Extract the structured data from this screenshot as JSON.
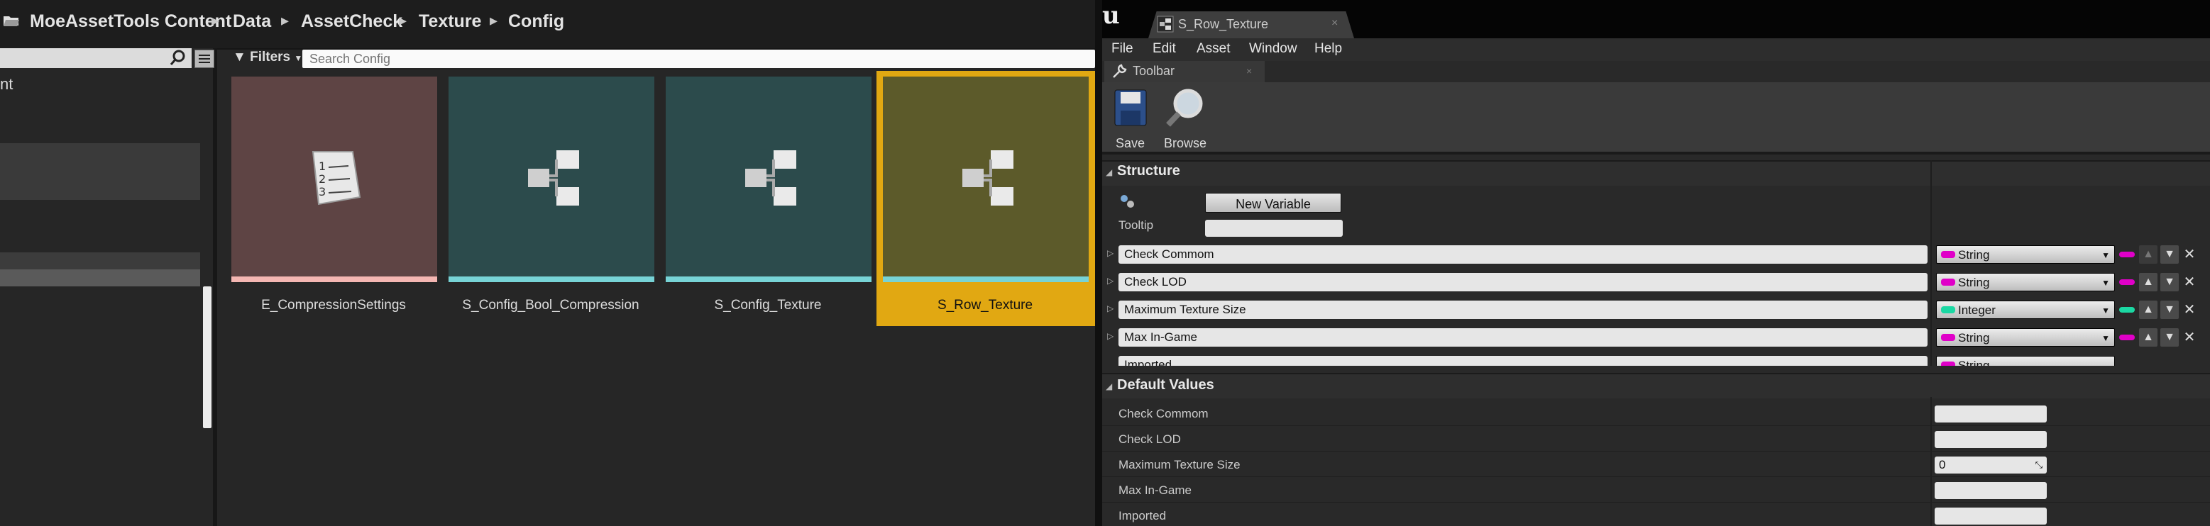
{
  "content_browser": {
    "breadcrumb": [
      "MoeAssetTools Content",
      "Data",
      "AssetCheck",
      "Texture",
      "Config"
    ],
    "tree_partial_label": "nt",
    "filters_label": "Filters",
    "search_placeholder": "Search Config",
    "assets": [
      {
        "name": "E_CompressionSettings",
        "color": "#5e4444",
        "bar": "#f4b6b2",
        "icon": "enum-list-icon"
      },
      {
        "name": "S_Config_Bool_Compression",
        "color": "#2c4b4c",
        "bar": "#77d3d6",
        "icon": "struct-icon"
      },
      {
        "name": "S_Config_Texture",
        "color": "#2c4b4c",
        "bar": "#77d3d6",
        "icon": "struct-icon"
      },
      {
        "name": "S_Row_Texture",
        "color": "#5c5a2a",
        "bar": "#77d3d6",
        "icon": "struct-icon",
        "selected": true
      }
    ],
    "selection_color": "#e1a812"
  },
  "editor": {
    "tab_title": "S_Row_Texture",
    "menu": [
      "File",
      "Edit",
      "Asset",
      "Window",
      "Help"
    ],
    "toolbar_tab": "Toolbar",
    "toolbar": {
      "save_label": "Save",
      "browse_label": "Browse"
    },
    "structure_label": "Structure",
    "new_variable_label": "New Variable",
    "tooltip_label": "Tooltip",
    "variables": [
      {
        "name": "Check Commom",
        "type": "String",
        "type_color": "#e000c8"
      },
      {
        "name": "Check LOD",
        "type": "String",
        "type_color": "#e000c8"
      },
      {
        "name": "Maximum Texture Size",
        "type": "Integer",
        "type_color": "#1bd8a3"
      },
      {
        "name": "Max In-Game",
        "type": "String",
        "type_color": "#e000c8"
      },
      {
        "name": "Imported",
        "type": "String",
        "type_color": "#e000c8"
      }
    ],
    "default_values_label": "Default Values",
    "defaults": [
      {
        "name": "Check Commom",
        "value": ""
      },
      {
        "name": "Check LOD",
        "value": ""
      },
      {
        "name": "Maximum Texture Size",
        "value": "0"
      },
      {
        "name": "Max In-Game",
        "value": ""
      },
      {
        "name": "Imported",
        "value": ""
      }
    ]
  }
}
